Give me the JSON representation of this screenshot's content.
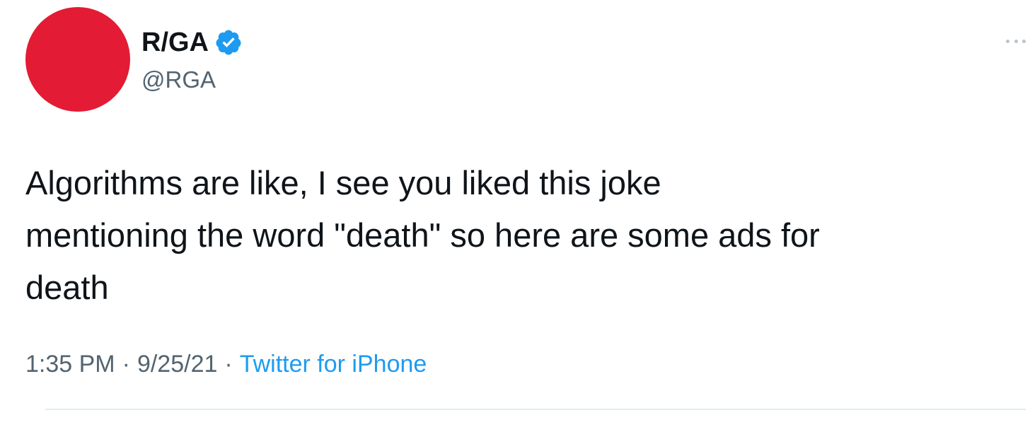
{
  "tweet": {
    "author": {
      "display_name": "R/GA",
      "handle": "@RGA",
      "verified": true,
      "avatar_color": "#e31b35",
      "verified_icon": "verified-badge-icon"
    },
    "text": "Algorithms are like, I see you liked this joke\nmentioning the word \"death\" so here are some ads for\ndeath",
    "meta": {
      "time": "1:35 PM",
      "separator": "·",
      "date": "9/25/21",
      "source": "Twitter for iPhone"
    },
    "more_icon": "more-options-icon",
    "colors": {
      "text": "#0f1419",
      "secondary": "#536471",
      "link": "#1d9bf0",
      "verified": "#1d9bf0"
    }
  }
}
